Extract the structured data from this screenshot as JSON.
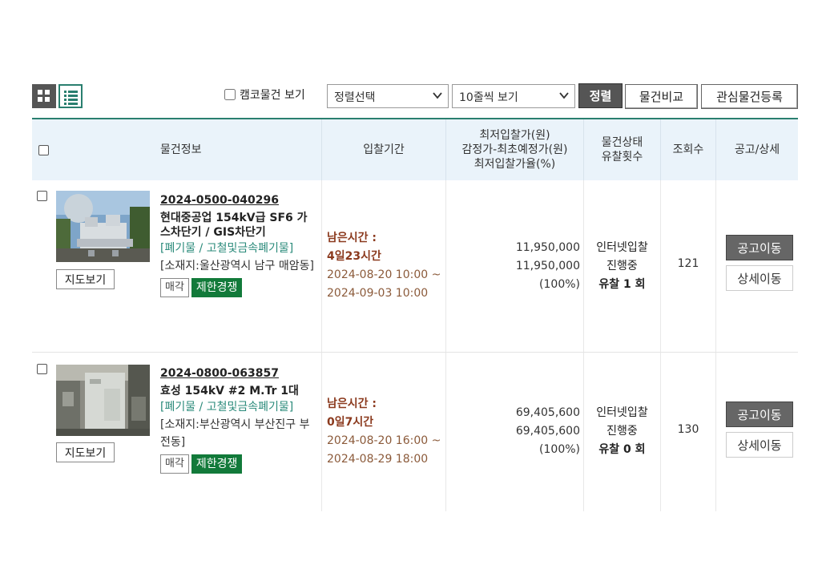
{
  "toolbar": {
    "camco_label": "캠코물건 보기",
    "sort_select": "정렬선택",
    "rows_select": "10줄씩 보기",
    "sort_button": "정렬",
    "compare_button": "물건비교",
    "watch_button": "관심물건등록"
  },
  "table": {
    "headers": {
      "info": "물건정보",
      "period": "입찰기간",
      "price_1": "최저입찰가(원)",
      "price_2": "감정가-최초예정가(원)",
      "price_3": "최저입찰가율(%)",
      "status_1": "물건상태",
      "status_2": "유찰횟수",
      "views": "조회수",
      "notice": "공고/상세"
    },
    "rows": [
      {
        "item_no": "2024-0500-040296",
        "title": "현대중공업 154kV급 SF6 가스차단기 / GIS차단기",
        "category": "[폐기물 / 고철및금속폐기물]",
        "location": "[소재지:울산광역시 남구 매암동]",
        "map_button": "지도보기",
        "tag_sale": "매각",
        "tag_limit": "제한경쟁",
        "remain_label": "남은시간 :",
        "remain": "4일23시간",
        "start": "2024-08-20 10:00 ~",
        "end": "2024-09-03 10:00",
        "min_price": "11,950,000",
        "appraisal": "11,950,000",
        "rate": "(100%)",
        "state_1": "인터넷입찰",
        "state_2": "진행중",
        "fail_count": "유찰 1 회",
        "views": "121",
        "notice_button": "공고이동",
        "detail_button": "상세이동"
      },
      {
        "item_no": "2024-0800-063857",
        "title": "효성 154kV #2 M.Tr 1대",
        "category": "[폐기물 / 고철및금속폐기물]",
        "location": "[소재지:부산광역시 부산진구 부전동]",
        "map_button": "지도보기",
        "tag_sale": "매각",
        "tag_limit": "제한경쟁",
        "remain_label": "남은시간 :",
        "remain": "0일7시간",
        "start": "2024-08-20 16:00 ~",
        "end": "2024-08-29 18:00",
        "min_price": "69,405,600",
        "appraisal": "69,405,600",
        "rate": "(100%)",
        "state_1": "인터넷입찰",
        "state_2": "진행중",
        "fail_count": "유찰 0 회",
        "views": "130",
        "notice_button": "공고이동",
        "detail_button": "상세이동"
      }
    ]
  },
  "colors": {
    "accent": "#2a7f6f",
    "limit_tag": "#127a3a",
    "period_text": "#8b3a1e",
    "header_bg": "#eaf3fa"
  },
  "icons": [
    "grid-view-icon",
    "list-view-icon",
    "dropdown-chevron-icon"
  ]
}
